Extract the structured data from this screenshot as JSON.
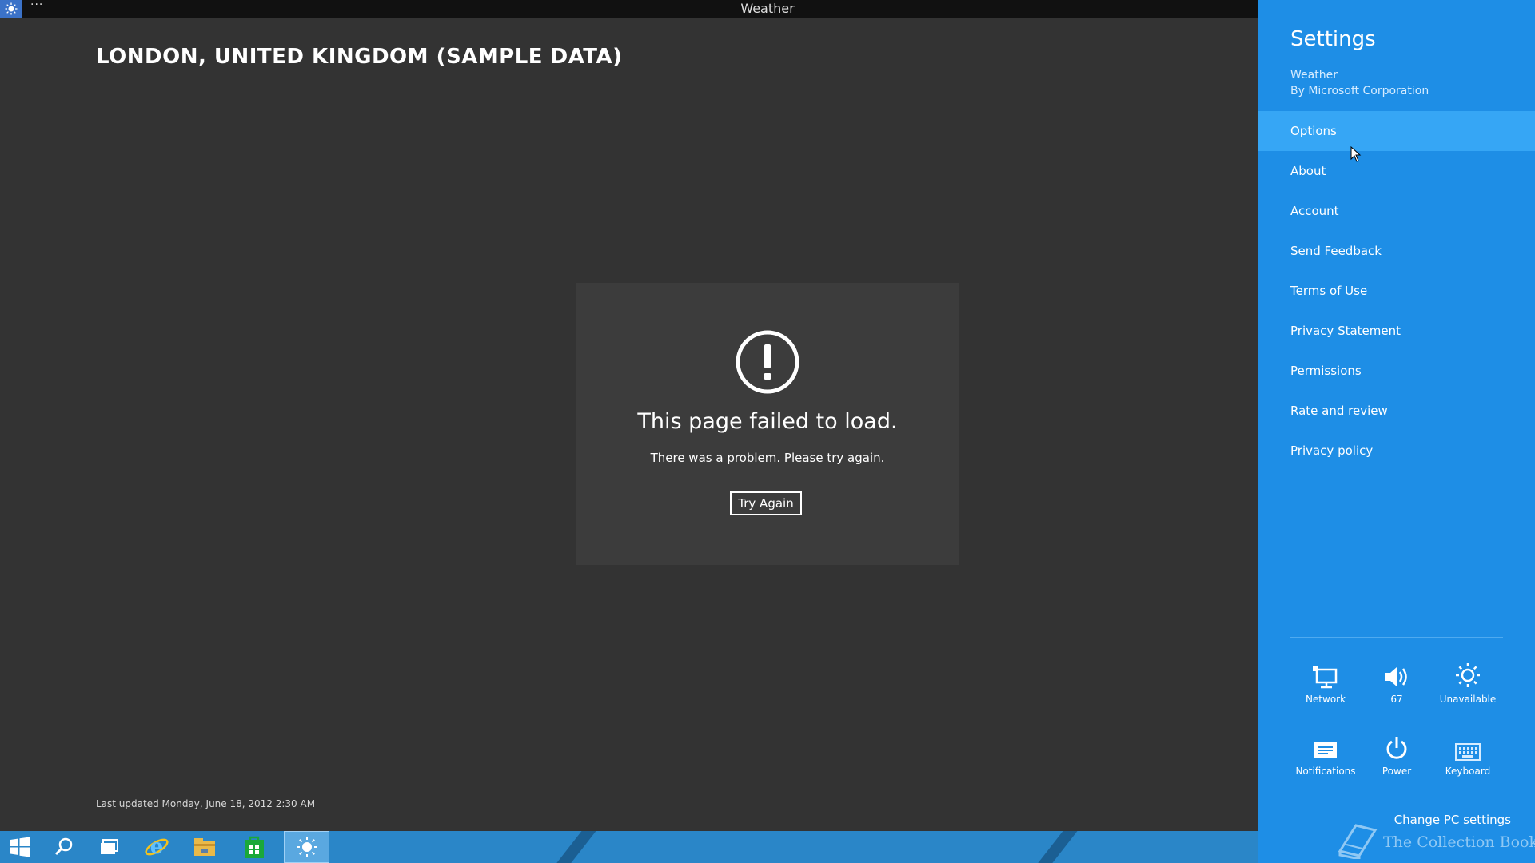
{
  "titlebar": {
    "title": "Weather",
    "more_label": "···"
  },
  "main": {
    "location": "LONDON, UNITED KINGDOM (SAMPLE DATA)",
    "error": {
      "title": "This page failed to load.",
      "message": "There was a problem. Please try again.",
      "button_label": "Try Again"
    },
    "last_updated": "Last updated Monday, June 18, 2012 2:30 AM"
  },
  "taskbar": {
    "items": [
      {
        "icon": "windows-start-icon"
      },
      {
        "icon": "search-icon"
      },
      {
        "icon": "task-view-icon"
      },
      {
        "icon": "internet-explorer-icon"
      },
      {
        "icon": "file-explorer-icon"
      },
      {
        "icon": "store-icon"
      },
      {
        "icon": "weather-app-icon",
        "active": true
      }
    ]
  },
  "settings": {
    "title": "Settings",
    "app_name": "Weather",
    "publisher": "By Microsoft Corporation",
    "menu": [
      {
        "label": "Options",
        "highlighted": true
      },
      {
        "label": "About"
      },
      {
        "label": "Account"
      },
      {
        "label": "Send Feedback"
      },
      {
        "label": "Terms of Use"
      },
      {
        "label": "Privacy Statement"
      },
      {
        "label": "Permissions"
      },
      {
        "label": "Rate and review"
      },
      {
        "label": "Privacy policy"
      }
    ],
    "quick_settings": [
      {
        "label": "Network",
        "icon": "network-icon"
      },
      {
        "label": "67",
        "icon": "volume-icon"
      },
      {
        "label": "Unavailable",
        "icon": "brightness-icon"
      },
      {
        "label": "Notifications",
        "icon": "notifications-icon"
      },
      {
        "label": "Power",
        "icon": "power-icon"
      },
      {
        "label": "Keyboard",
        "icon": "keyboard-icon"
      }
    ],
    "change_pc_settings": "Change PC settings",
    "watermark_text": "The Collection Book"
  },
  "colors": {
    "background": "#333333",
    "charm": "#1e8ee6",
    "charm_highlight": "#36a6f5",
    "taskbar": "#2a86c8"
  }
}
